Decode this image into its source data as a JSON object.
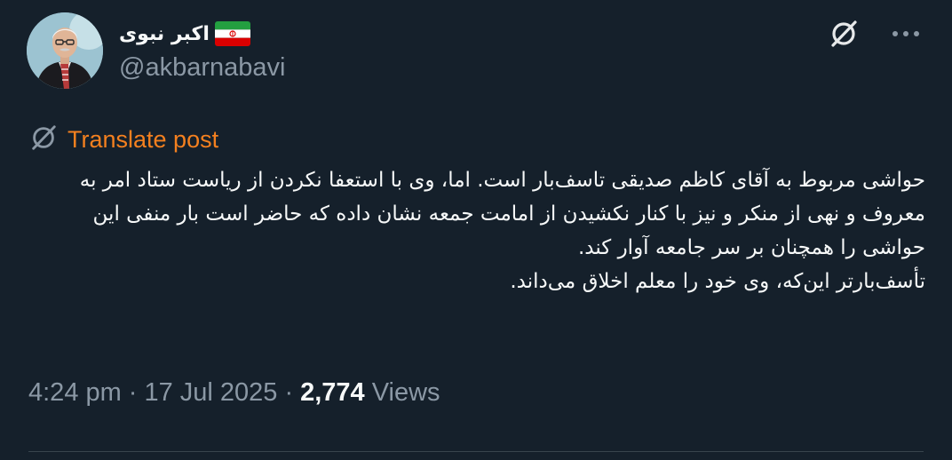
{
  "author": {
    "display_name": "اکبر نبوی",
    "handle": "@akbarnabavi",
    "flag_icon": "iran-flag-icon",
    "avatar_icon": "avatar"
  },
  "actions": {
    "grok_icon": "grok-icon",
    "more_icon": "more-icon",
    "more_label": "•••"
  },
  "translate": {
    "icon": "translate-icon",
    "label": "Translate post",
    "color": "#f4801f"
  },
  "post": {
    "paragraph_1": "حواشی مربوط به آقای کاظم صدیقی تاسف‌بار است. اما، وی با استعفا نکردن از ریاست ستاد امر به معروف و نهی از منکر و نیز با کنار نکشیدن از امامت جمعه نشان داده که حاضر است بار منفی این حواشی را همچنان بر سر جامعه آوار کند.",
    "paragraph_2": "تأسف‌بارتر این‌که، وی خود را معلم اخلاق می‌داند."
  },
  "meta": {
    "time": "4:24 pm",
    "separator": "·",
    "date": "17 Jul 2025",
    "views_count": "2,774",
    "views_label": "Views"
  },
  "colors": {
    "background": "#15202b",
    "text": "#f7f9f9",
    "secondary": "#8b98a5",
    "accent": "#f4801f"
  }
}
